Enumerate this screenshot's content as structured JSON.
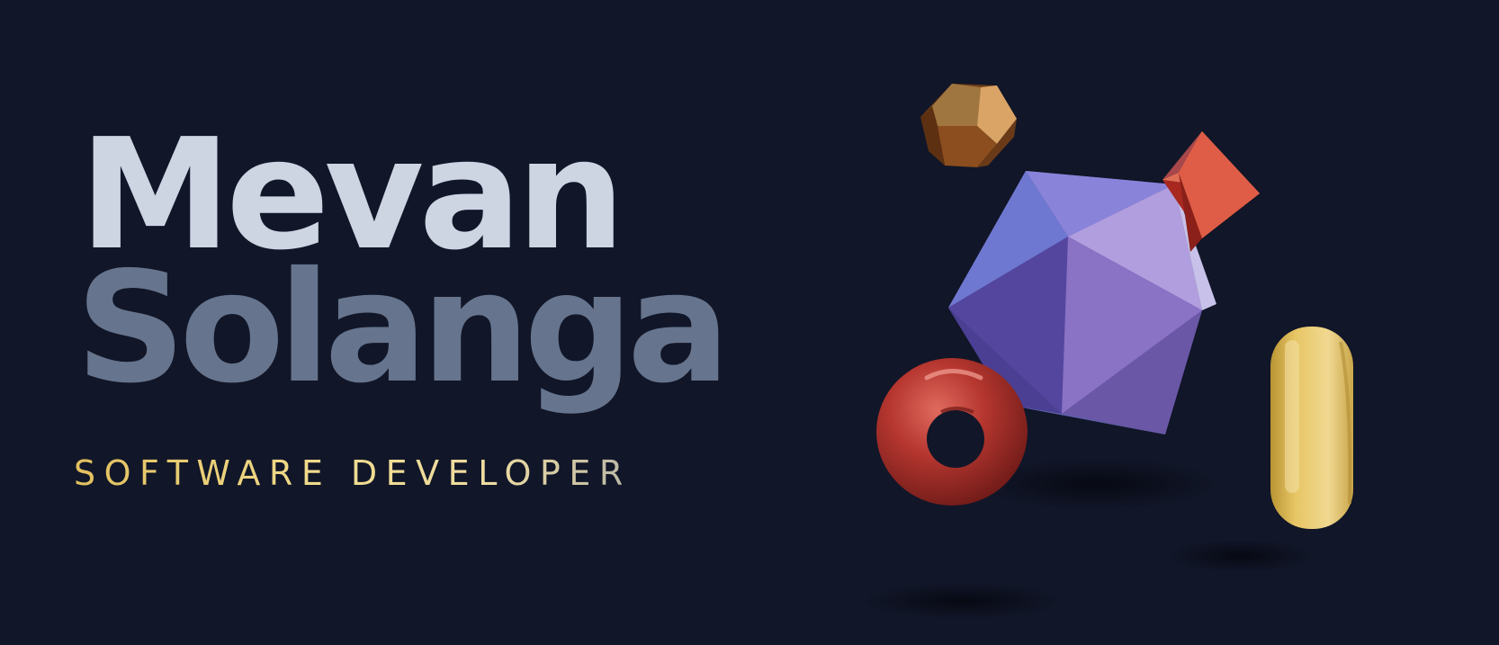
{
  "hero": {
    "first_name": "Mevan",
    "last_name": "Solanga",
    "role": "SOFTWARE DEVELOPER"
  },
  "colors": {
    "background": "#111628",
    "first_name": "#cdd5e3",
    "last_name": "#66748d",
    "role_gold": "#e9cf73",
    "icosahedron": "#8a72c4",
    "dodecahedron": "#b57a3d",
    "octahedron": "#d2493a",
    "torus": "#b63a35",
    "capsule": "#e6c76a"
  },
  "scene": {
    "shapes": [
      "icosahedron",
      "dodecahedron",
      "octahedron",
      "torus",
      "capsule"
    ]
  }
}
